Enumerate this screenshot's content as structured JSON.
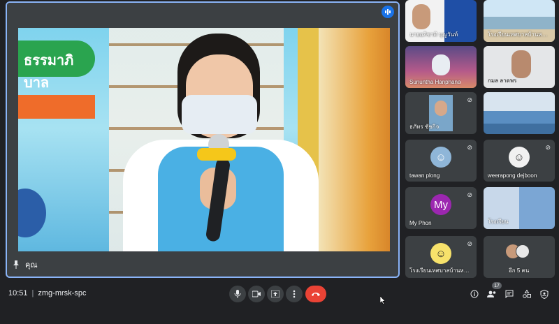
{
  "stage": {
    "name": "คุณ",
    "poster_text": "ธรรมาภิบาล"
  },
  "participants": [
    {
      "name": "นายอภิชาติ บุญวันท์",
      "type": "video"
    },
    {
      "name": "โรงเรียนเทศบาลบ้านหนอง...",
      "type": "video"
    },
    {
      "name": "Sununtha Hanphana",
      "type": "video"
    },
    {
      "name": "กมล ลาดพร",
      "type": "video"
    },
    {
      "name": "ธภัทร ชัชกิจ",
      "type": "video"
    },
    {
      "name": "",
      "type": "video"
    },
    {
      "name": "tawan plong",
      "type": "avatar"
    },
    {
      "name": "weerapong dejboon",
      "type": "avatar"
    },
    {
      "name": "My Phon",
      "type": "initial",
      "initials": "My"
    },
    {
      "name": "โรงเรียน",
      "type": "video"
    },
    {
      "name": "โรงเรียนเทศบาลบ้านหนอง...",
      "type": "avatar"
    },
    {
      "name": "อีก 5 คน",
      "type": "more"
    }
  ],
  "bottom_bar": {
    "time": "10:51",
    "meeting_code": "zmg-mrsk-spc",
    "people_count": "17"
  },
  "colors": {
    "background": "#202124",
    "tile": "#3c4043",
    "active_border": "#8ab4f8",
    "end_call": "#ea4335",
    "avatar_purple": "#9c27b0"
  },
  "icons": {
    "mic": "mic-icon",
    "camera": "camera-icon",
    "present": "present-icon",
    "more": "more-vert-icon",
    "end_call": "end-call-icon",
    "info": "info-icon",
    "people": "people-icon",
    "chat": "chat-icon",
    "activities": "activities-icon",
    "host": "host-controls-icon"
  }
}
